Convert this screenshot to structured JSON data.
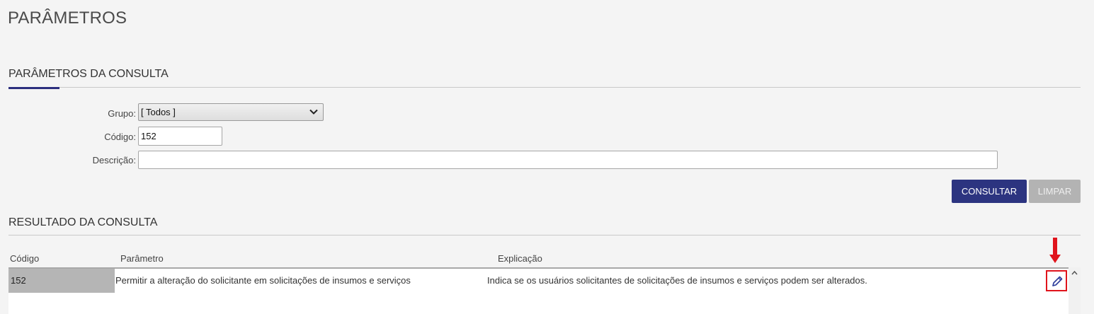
{
  "page": {
    "title": "PARÂMETROS"
  },
  "query_section": {
    "title": "PARÂMETROS DA CONSULTA",
    "grupo_label": "Grupo:",
    "grupo_value": "[ Todos ]",
    "codigo_label": "Código:",
    "codigo_value": "152",
    "descricao_label": "Descrição:",
    "descricao_value": "",
    "consultar_label": "CONSULTAR",
    "limpar_label": "LIMPAR"
  },
  "result_section": {
    "title": "RESULTADO DA CONSULTA",
    "columns": [
      "Código",
      "Parâmetro",
      "Explicação"
    ],
    "rows": [
      {
        "codigo": "152",
        "parametro": "Permitir a alteração do solicitante em solicitações de insumos e serviços",
        "explicacao": "Indica se os usuários solicitantes de solicitações de insumos e serviços podem ser alterados."
      }
    ]
  },
  "colors": {
    "accent": "#2c2f7e",
    "primary_button": "#2c3480",
    "disabled_button": "#b3b3b3",
    "annotation_red": "#e0141c",
    "edit_icon": "#2c3b9a"
  },
  "icons": {
    "edit": "pencil-icon",
    "annotation": "arrow-down-icon",
    "select": "chevron-down-icon",
    "scroll": "scroll-up-icon"
  }
}
